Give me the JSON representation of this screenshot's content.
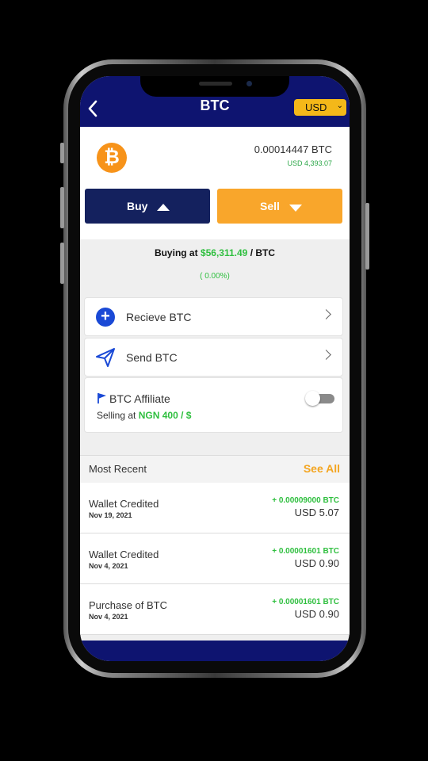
{
  "header": {
    "title": "BTC",
    "currency": "USD"
  },
  "wallet": {
    "balance": "0.00014447 BTC",
    "balance_usd": "USD 4,393.07"
  },
  "actions": {
    "buy_label": "Buy",
    "sell_label": "Sell"
  },
  "rate": {
    "prefix": "Buying at",
    "price": "$56,311.49",
    "suffix": "/ BTC",
    "change": "( 0.00%)"
  },
  "menu": {
    "receive_label": "Recieve BTC",
    "send_label": "Send BTC"
  },
  "affiliate": {
    "label": "BTC Affiliate",
    "selling_prefix": "Selling at",
    "selling_value": "NGN 400 / $",
    "enabled": false
  },
  "recent": {
    "title": "Most Recent",
    "see_all": "See All",
    "items": [
      {
        "title": "Wallet Credited",
        "date": "Nov 19, 2021",
        "amount": "+ 0.00009000 BTC",
        "usd": "USD 5.07"
      },
      {
        "title": "Wallet Credited",
        "date": "Nov 4, 2021",
        "amount": "+ 0.00001601 BTC",
        "usd": "USD 0.90"
      },
      {
        "title": "Purchase of BTC",
        "date": "Nov 4, 2021",
        "amount": "+ 0.00001601 BTC",
        "usd": "USD 0.90"
      }
    ]
  },
  "colors": {
    "header_bg": "#0e1470",
    "buy_bg": "#14215e",
    "sell_bg": "#f9a62b",
    "accent_orange": "#f3a521",
    "positive_green": "#2fbf3f",
    "bitcoin_orange": "#f7931a"
  },
  "icons": {
    "back": "chevron-left-icon",
    "currency_caret": "chevron-down-icon",
    "buy": "caret-up-icon",
    "sell": "caret-down-icon",
    "receive": "plus-circle-icon",
    "send": "paper-plane-icon",
    "affiliate": "flag-icon"
  }
}
